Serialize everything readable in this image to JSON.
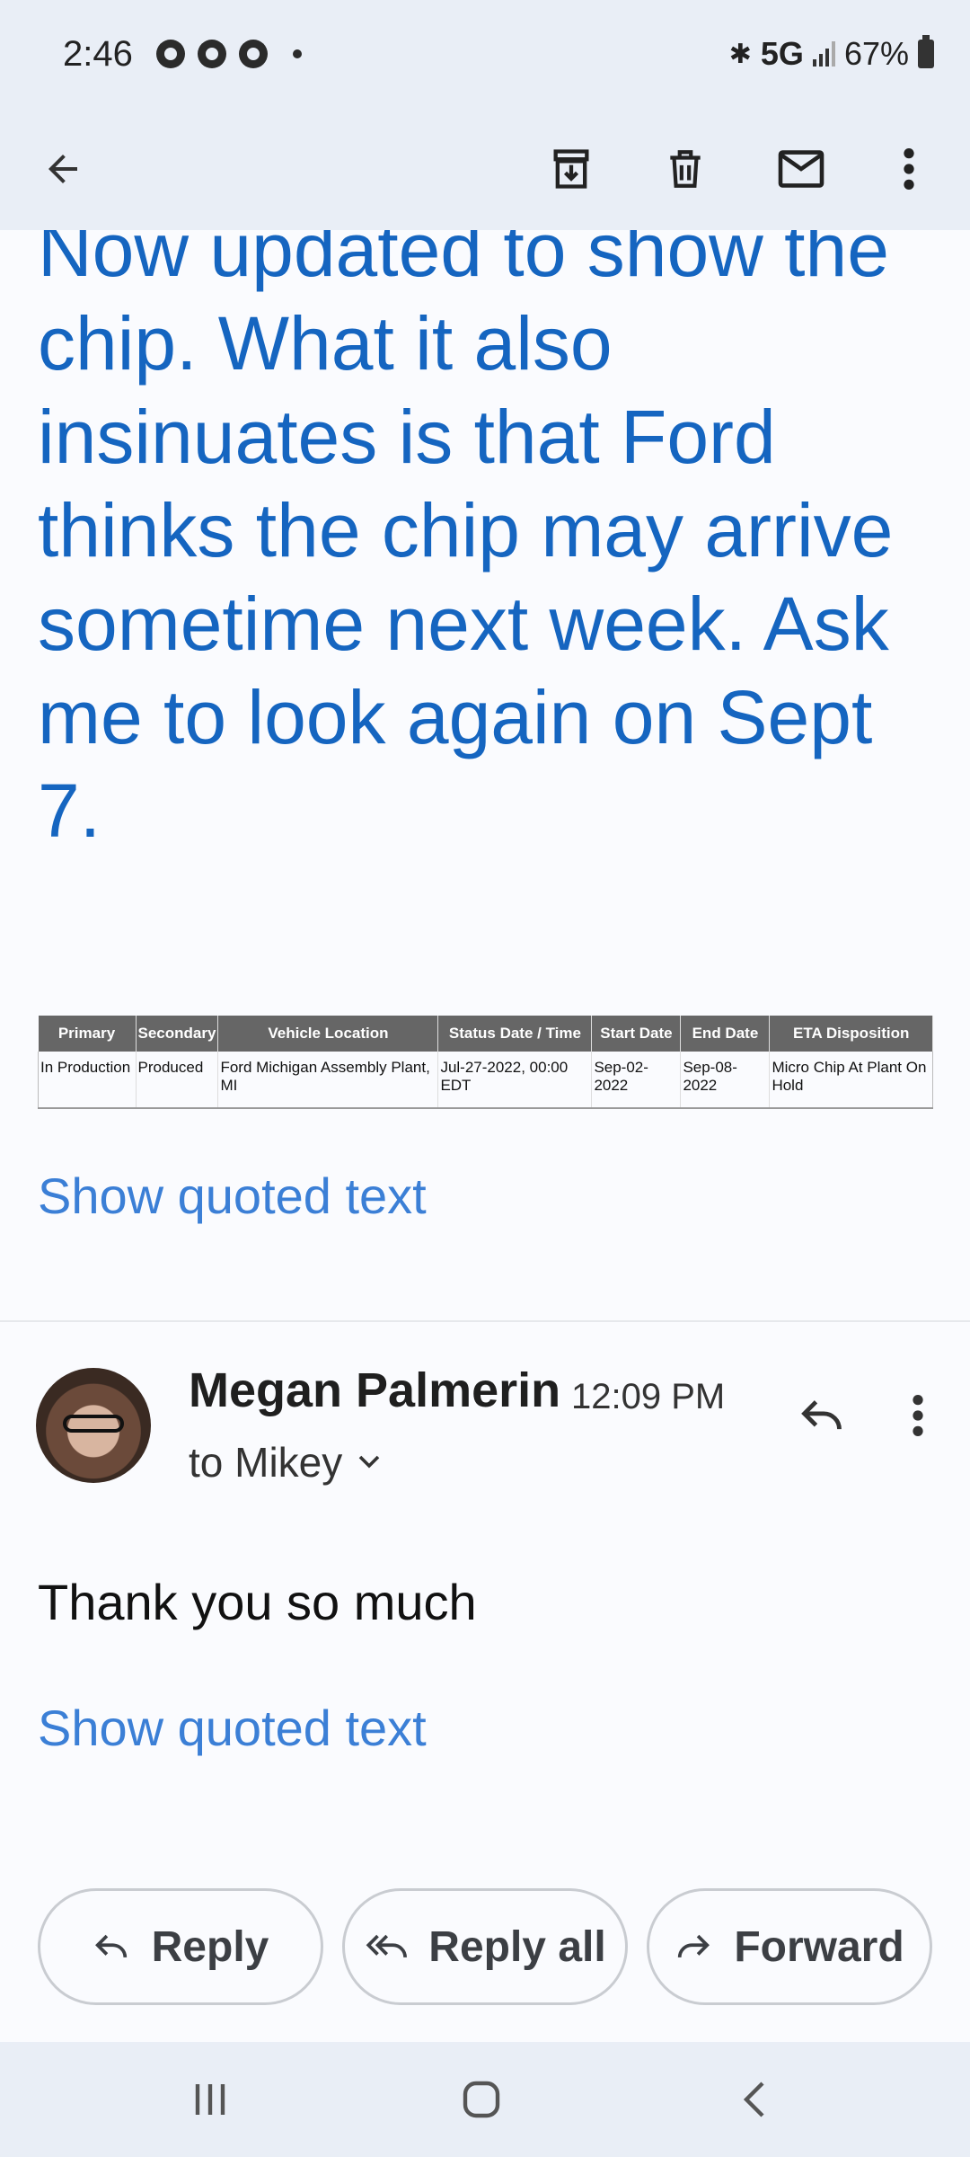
{
  "status_bar": {
    "time": "2:46",
    "network": "5G",
    "battery": "67%"
  },
  "toolbar": {
    "back_icon": "arrow-back-icon",
    "archive_icon": "archive-icon",
    "delete_icon": "trash-icon",
    "unread_icon": "mail-icon",
    "more_icon": "more-vert-icon"
  },
  "email": {
    "body_text": "Now updated to show the chip.  What it also insinuates is that Ford thinks the chip may arrive sometime next week.  Ask me to look again on Sept 7.",
    "table": {
      "headers": [
        "Primary",
        "Secondary",
        "Vehicle Location",
        "Status Date / Time",
        "Start Date",
        "End Date",
        "ETA Disposition"
      ],
      "row": [
        "In Production",
        "Produced",
        "Ford Michigan Assembly Plant, MI",
        "Jul-27-2022, 00:00 EDT",
        "Sep-02-2022",
        "Sep-08-2022",
        "Micro Chip At Plant On Hold"
      ]
    },
    "show_quoted_1": "Show quoted text"
  },
  "reply_message": {
    "sender": "Megan Palmerin",
    "time": "12:09 PM",
    "to": "to Mikey",
    "body": "Thank you so much",
    "show_quoted": "Show quoted text"
  },
  "actions": {
    "reply": "Reply",
    "reply_all": "Reply all",
    "forward": "Forward"
  },
  "colors": {
    "accent_text": "#1565c0",
    "link": "#3b7fd6",
    "bars": "#e9eef6"
  }
}
